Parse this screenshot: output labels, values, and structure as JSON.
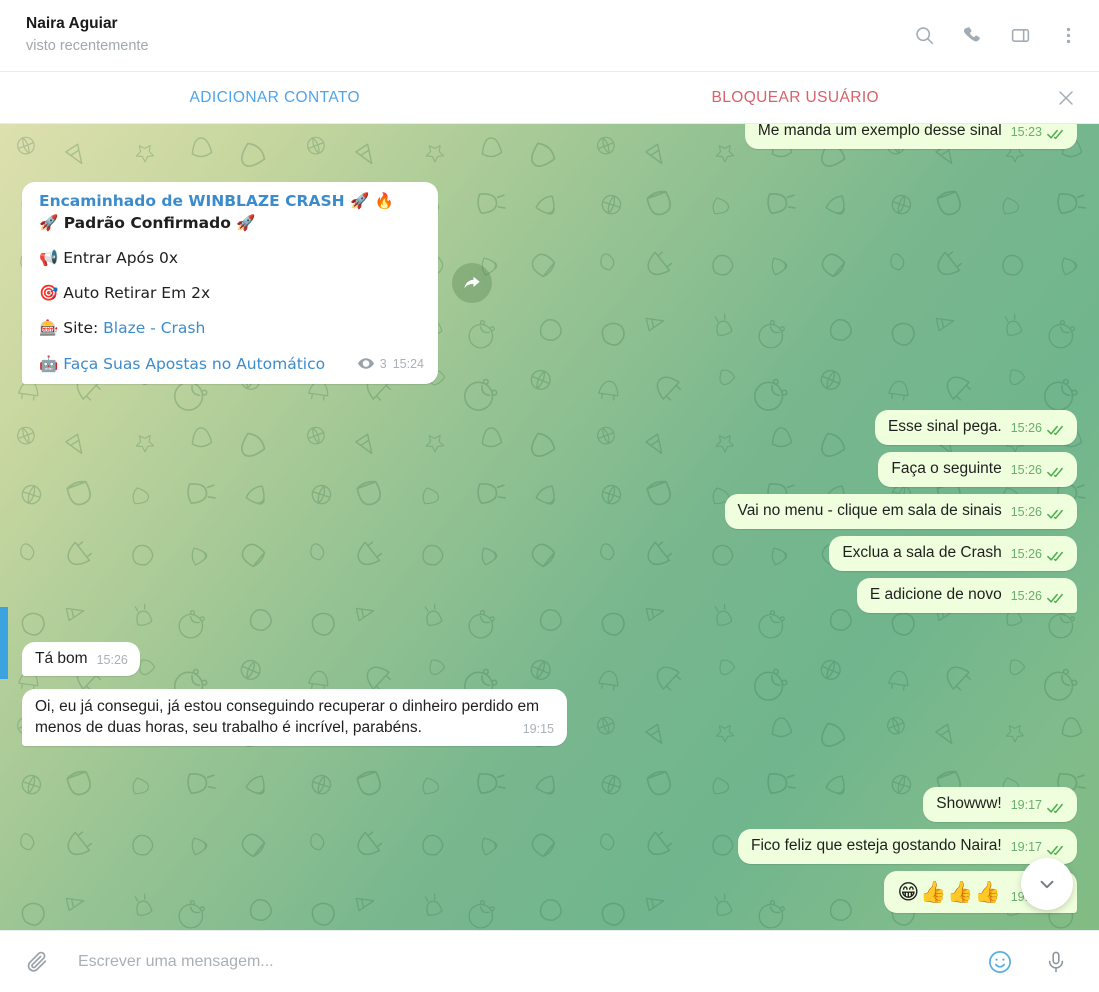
{
  "header": {
    "peer_name": "Naira Aguiar",
    "peer_status": "visto recentemente",
    "icons": [
      "search-icon",
      "phone-icon",
      "panel-icon",
      "more-vertical-icon"
    ]
  },
  "action_bar": {
    "add_contact_label": "ADICIONAR CONTATO",
    "block_user_label": "BLOQUEAR USUÁRIO",
    "close_icon": "close-icon",
    "add_color": "#4ea4eb",
    "block_color": "#d9606a"
  },
  "messages": [
    {
      "id": "m1",
      "direction": "out",
      "text": "Me manda um exemplo desse sinal",
      "time": "15:23",
      "status": "read"
    },
    {
      "id": "m2",
      "direction": "in",
      "type": "forwarded_card",
      "forwarded_from": "Encaminhado de WINBLAZE CRASH 🚀 🔥",
      "lines": [
        {
          "text": "🚀 Padrão Confirmado 🚀",
          "bold": true
        },
        {
          "text": "📢 Entrar Após 0x",
          "bold": false
        },
        {
          "text": "🎯 Auto Retirar Em 2x",
          "bold": false
        },
        {
          "text": "🎰 Site: ",
          "link": "Blaze - Crash",
          "bold": false
        },
        {
          "text": "🤖 ",
          "link": "Faça Suas Apostas no Automático",
          "bold": false
        }
      ],
      "views": "3",
      "time": "15:24",
      "forward_button": "forward-icon"
    },
    {
      "id": "m3",
      "direction": "out",
      "text": "Esse sinal pega.",
      "time": "15:26",
      "status": "read"
    },
    {
      "id": "m4",
      "direction": "out",
      "text": "Faça o seguinte",
      "time": "15:26",
      "status": "read"
    },
    {
      "id": "m5",
      "direction": "out",
      "text": "Vai no menu - clique em sala de sinais",
      "time": "15:26",
      "status": "read"
    },
    {
      "id": "m6",
      "direction": "out",
      "text": "Exclua a sala de Crash",
      "time": "15:26",
      "status": "read"
    },
    {
      "id": "m7",
      "direction": "out",
      "text": "E adicione de novo",
      "time": "15:26",
      "status": "read",
      "tail": true
    },
    {
      "id": "m8",
      "direction": "in",
      "text": "Tá bom",
      "time": "15:26",
      "tail": true
    },
    {
      "id": "m9",
      "direction": "in",
      "multiline": true,
      "text": "Oi, eu já consegui, já estou conseguindo recuperar o dinheiro perdido em menos de duas horas, seu trabalho é incrível, parabéns.",
      "time": "19:15",
      "tail": true
    },
    {
      "id": "m10",
      "direction": "out",
      "text": "Showww!",
      "time": "19:17",
      "status": "read"
    },
    {
      "id": "m11",
      "direction": "out",
      "text": "Fico feliz que esteja gostando Naira!",
      "time": "19:17",
      "status": "read"
    },
    {
      "id": "m12",
      "direction": "out",
      "text": "😁👍👍👍",
      "time": "19:17",
      "status": "read",
      "emoji_only": true,
      "tail": true
    }
  ],
  "scroll_down_button": "chevron-down-icon",
  "scrollbar": {
    "name": "chat-scrollbar",
    "color": "#3ba3e0"
  },
  "composer": {
    "attach_icon": "paperclip-icon",
    "placeholder": "Escrever uma mensagem...",
    "value": "",
    "emoji_icon": "smiley-icon",
    "mic_icon": "microphone-icon"
  }
}
